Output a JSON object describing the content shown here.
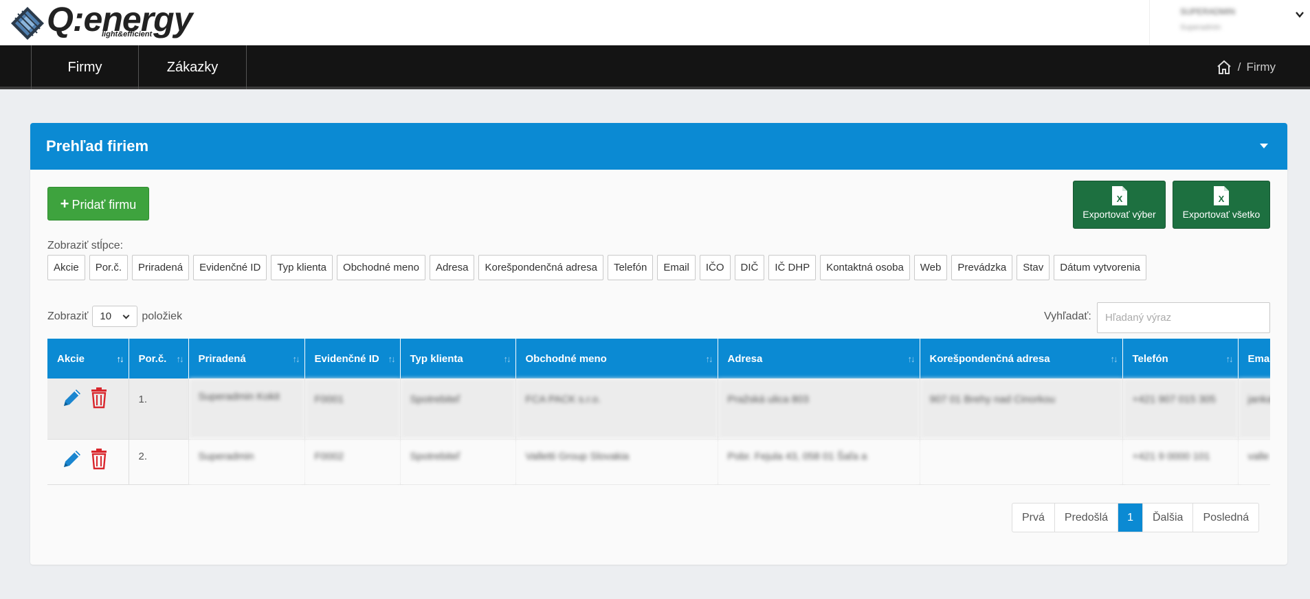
{
  "logo": {
    "text": "Q:energy",
    "tagline": "light&efficient"
  },
  "user": {
    "name": "SUPERADMIN",
    "role": "Superadmin"
  },
  "nav": {
    "items": [
      {
        "label": "Firmy"
      },
      {
        "label": "Zákazky"
      }
    ]
  },
  "breadcrumb": {
    "separator": "/",
    "current": "Firmy"
  },
  "card": {
    "title": "Prehľad firiem"
  },
  "actions": {
    "add_label": "Pridať firmu",
    "export_selection": "Exportovať výber",
    "export_all": "Exportovať všetko"
  },
  "columns_toggle": {
    "label": "Zobraziť stĺpce:",
    "items": [
      "Akcie",
      "Por.č.",
      "Priradená",
      "Evidenčné ID",
      "Typ klienta",
      "Obchodné meno",
      "Adresa",
      "Korešpondenčná adresa",
      "Telefón",
      "Email",
      "IČO",
      "DIČ",
      "IČ DHP",
      "Kontaktná osoba",
      "Web",
      "Prevádzka",
      "Stav",
      "Dátum vytvorenia"
    ]
  },
  "length": {
    "prefix": "Zobraziť",
    "value": "10",
    "suffix": "položiek"
  },
  "search": {
    "label": "Vyhľadať:",
    "placeholder": "Hľadaný výraz"
  },
  "table": {
    "headers": [
      "Akcie",
      "Por.č.",
      "Priradená",
      "Evidenčné ID",
      "Typ klienta",
      "Obchodné meno",
      "Adresa",
      "Korešpondenčná adresa",
      "Telefón",
      "Emai"
    ],
    "rows": [
      {
        "num": "1.",
        "assigned": "Superadmin Kokit",
        "id": "F0001",
        "type": "Spotrebiteľ",
        "name": "FCA PACK s.r.o.",
        "address": "Pražská ulica 803",
        "corr": "907 01 Brehy nad Cinorkou",
        "phone": "+421 907 015 305",
        "email": "jankal"
      },
      {
        "num": "2.",
        "assigned": "Superadmin",
        "id": "F0002",
        "type": "Spotrebiteľ",
        "name": "Valletti Group Slovakia",
        "address": "Pobr. Fejula 43, 058 01 Šaľa a",
        "corr": "",
        "phone": "+421 9 0000 101",
        "email": "valle"
      }
    ]
  },
  "pagination": {
    "first": "Prvá",
    "prev": "Predošlá",
    "current": "1",
    "next": "Ďalšia",
    "last": "Posledná"
  },
  "colors": {
    "primary": "#0b8ad3",
    "success": "#3ea33e",
    "excel": "#1d7040",
    "danger": "#d9262c",
    "nav": "#141414"
  }
}
